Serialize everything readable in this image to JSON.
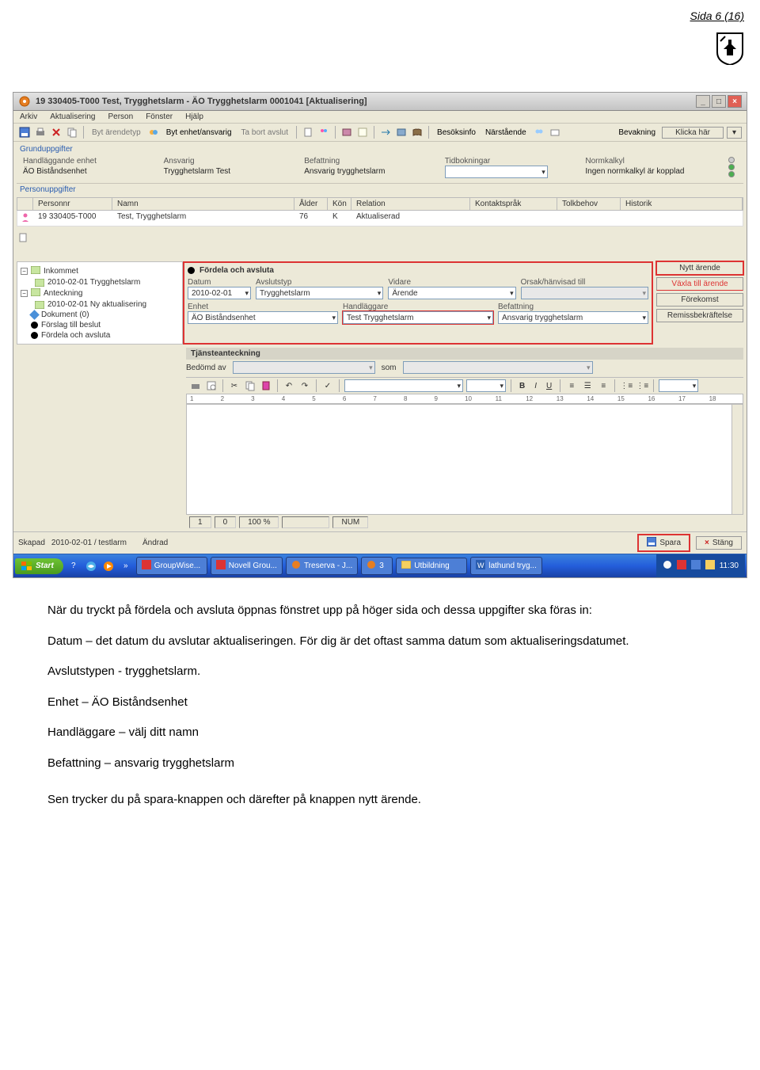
{
  "page_label": "Sida 6 (16)",
  "window": {
    "title": "19 330405-T000  Test, Trygghetslarm   -   ÄO Trygghetslarm  0001041   [Aktualisering]"
  },
  "menubar": [
    "Arkiv",
    "Aktualisering",
    "Person",
    "Fönster",
    "Hjälp"
  ],
  "toolbar": {
    "byt_arendetyp": "Byt ärendetyp",
    "byt_enhet": "Byt enhet/ansvarig",
    "ta_bort_avslut": "Ta bort avslut",
    "besoksinfo": "Besöksinfo",
    "narstaende": "Närstående",
    "bevakning": "Bevakning",
    "klicka_har": "Klicka här"
  },
  "grund": {
    "section": "Grunduppgifter",
    "handlaggande_lbl": "Handläggande enhet",
    "handlaggande_val": "ÄO Biståndsenhet",
    "ansvarig_lbl": "Ansvarig",
    "ansvarig_val": "Trygghetslarm Test",
    "befattning_lbl": "Befattning",
    "befattning_val": "Ansvarig trygghetslarm",
    "tidbokningar_lbl": "Tidbokningar",
    "normkalkyl_lbl": "Normkalkyl",
    "normkalkyl_val": "Ingen normkalkyl är kopplad"
  },
  "person": {
    "section": "Personuppgifter",
    "cols": {
      "pnr": "Personnr",
      "namn": "Namn",
      "alder": "Ålder",
      "kon": "Kön",
      "rel": "Relation",
      "ksprak": "Kontaktspråk",
      "tolk": "Tolkbehov",
      "hist": "Historik"
    },
    "row": {
      "pnr": "19 330405-T000",
      "namn": "Test, Trygghetslarm",
      "alder": "76",
      "kon": "K",
      "rel": "Aktualiserad"
    }
  },
  "tree": {
    "inkommet": "Inkommet",
    "inkommet_child": "2010-02-01 Trygghetslarm",
    "anteckning": "Anteckning",
    "anteckning_child": "2010-02-01 Ny aktualisering",
    "dokument": "Dokument (0)",
    "forslag": "Förslag till beslut",
    "fordela": "Fördela och avsluta"
  },
  "form": {
    "header": "Fördela och avsluta",
    "datum_lbl": "Datum",
    "datum_val": "2010-02-01",
    "avslutstyp_lbl": "Avslutstyp",
    "avslutstyp_val": "Trygghetslarm",
    "vidare_lbl": "Vidare",
    "vidare_val": "Ärende",
    "orsak_lbl": "Orsak/hänvisad till",
    "enhet_lbl": "Enhet",
    "enhet_val": "ÄO Biståndsenhet",
    "handlaggare_lbl": "Handläggare",
    "handlaggare_val": "Test Trygghetslarm",
    "befattning_lbl": "Befattning",
    "befattning_val": "Ansvarig trygghetslarm"
  },
  "side_buttons": {
    "nytt": "Nytt ärende",
    "vaxla": "Växla till ärende",
    "forekomst": "Förekomst",
    "remiss": "Remissbekräftelse"
  },
  "tjanst_label": "Tjänsteanteckning",
  "bedomd": {
    "lbl": "Bedömd av",
    "som": "som"
  },
  "ruler": [
    "1",
    "2",
    "3",
    "4",
    "5",
    "6",
    "7",
    "8",
    "9",
    "10",
    "11",
    "12",
    "13",
    "14",
    "15",
    "16",
    "17",
    "18"
  ],
  "statusbar": {
    "row": "1",
    "col": "0",
    "zoom": "100 %",
    "num": "NUM"
  },
  "footer": {
    "skapad_lbl": "Skapad",
    "skapad_val": "2010-02-01 / testlarm",
    "andrad_lbl": "Ändrad",
    "spara": "Spara",
    "stang": "Stäng"
  },
  "taskbar": {
    "start": "Start",
    "items": [
      "GroupWise...",
      "Novell Grou...",
      "Treserva - J...",
      "3",
      "Utbildning",
      "lathund tryg..."
    ],
    "time": "11:30"
  },
  "body_text": {
    "p1": "När du tryckt på fördela och avsluta öppnas fönstret upp på höger sida och dessa uppgifter ska föras in:",
    "p2": "Datum – det datum du avslutar aktualiseringen. För dig är det oftast samma datum som aktualiseringsdatumet.",
    "p3": "Avslutstypen - trygghetslarm.",
    "p4": "Enhet – ÄO Biståndsenhet",
    "p5": "Handläggare – välj ditt namn",
    "p6": "Befattning – ansvarig trygghetslarm",
    "p7": "Sen trycker du på spara-knappen och därefter på knappen nytt ärende."
  }
}
